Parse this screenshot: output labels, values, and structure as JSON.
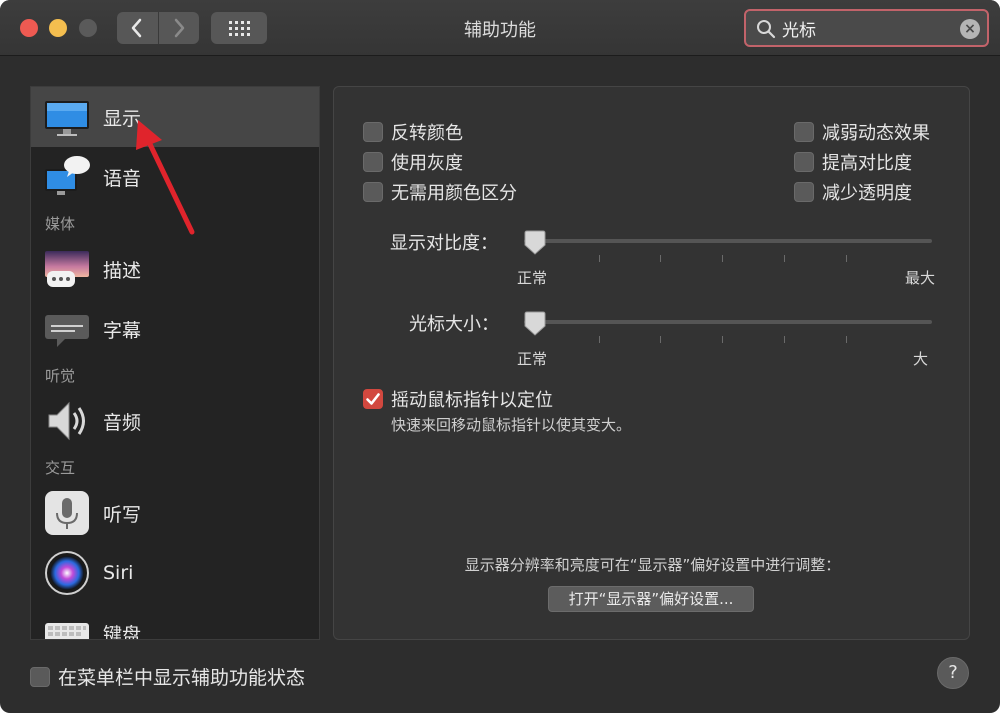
{
  "window": {
    "title": "辅助功能"
  },
  "toolbar": {
    "back_icon": "chevron-left-icon",
    "forward_icon": "chevron-right-icon",
    "grid_icon": "show-all-grid-icon"
  },
  "search": {
    "value": "光标",
    "clear_glyph": "×"
  },
  "sidebar": {
    "items": [
      {
        "label": "显示",
        "icon": "display-monitor-icon",
        "selected": true
      },
      {
        "label": "语音",
        "icon": "speech-bubble-monitor-icon"
      },
      {
        "label": "描述",
        "icon": "description-icon"
      },
      {
        "label": "字幕",
        "icon": "captions-icon"
      },
      {
        "label": "音频",
        "icon": "speaker-icon"
      },
      {
        "label": "听写",
        "icon": "microphone-icon"
      },
      {
        "label": "Siri",
        "icon": "siri-icon"
      },
      {
        "label": "键盘",
        "icon": "keyboard-icon"
      }
    ],
    "headers": [
      "媒体",
      "听觉",
      "交互"
    ]
  },
  "display": {
    "checkboxes_left": [
      {
        "label": "反转颜色",
        "checked": false
      },
      {
        "label": "使用灰度",
        "checked": false
      },
      {
        "label": "无需用颜色区分",
        "checked": false
      }
    ],
    "checkboxes_right": [
      {
        "label": "减弱动态效果",
        "checked": false
      },
      {
        "label": "提高对比度",
        "checked": false
      },
      {
        "label": "减少透明度",
        "checked": false
      }
    ],
    "contrast_slider": {
      "label": "显示对比度：",
      "min_label": "正常",
      "max_label": "最大",
      "value": 0
    },
    "cursor_slider": {
      "label": "光标大小：",
      "min_label": "正常",
      "max_label": "大",
      "value": 0
    },
    "shake_to_locate": {
      "label": "摇动鼠标指针以定位",
      "checked": true,
      "description": "快速来回移动鼠标指针以使其变大。"
    },
    "note": "显示器分辨率和亮度可在“显示器”偏好设置中进行调整：",
    "open_button": "打开“显示器”偏好设置..."
  },
  "footer": {
    "menu_bar_status": {
      "label": "在菜单栏中显示辅助功能状态",
      "checked": false
    },
    "help": "?"
  },
  "colors": {
    "accent_red": "#d2483f",
    "search_focus_ring": "#c2636a",
    "selected_row": "#464646",
    "annotation_arrow": "#e0242c"
  }
}
